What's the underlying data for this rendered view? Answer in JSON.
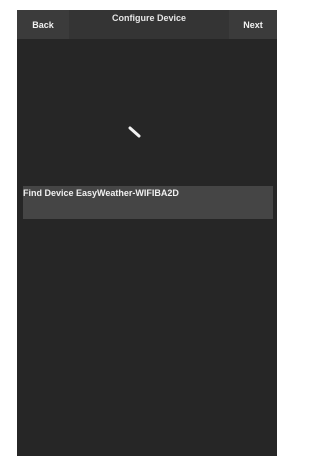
{
  "header": {
    "back_label": "Back",
    "title": "Configure Device",
    "next_label": "Next"
  },
  "main": {
    "status_text": "Find Device EasyWeather-WIFIBA2D",
    "spinner_icon": "loading-spinner-icon"
  },
  "colors": {
    "background": "#262626",
    "header": "#343434",
    "button": "#3b3b3b",
    "status_bar": "#454545",
    "text": "#f0f0f0"
  }
}
